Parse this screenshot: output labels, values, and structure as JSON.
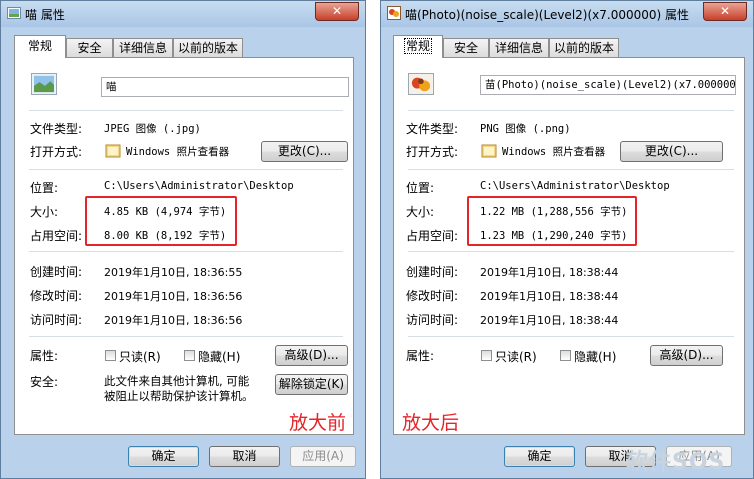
{
  "left": {
    "title": "喵 属性",
    "close": "✕",
    "tabs": [
      "常规",
      "安全",
      "详细信息",
      "以前的版本"
    ],
    "filename": "喵",
    "file_type_label": "文件类型:",
    "file_type": "JPEG 图像 (.jpg)",
    "opens_with_label": "打开方式:",
    "opens_with": "Windows 照片查看器",
    "change_button": "更改(C)...",
    "location_label": "位置:",
    "location": "C:\\Users\\Administrator\\Desktop",
    "size_label": "大小:",
    "size": "4.85 KB (4,974 字节)",
    "size_on_disk_label": "占用空间:",
    "size_on_disk": "8.00 KB (8,192 字节)",
    "created_label": "创建时间:",
    "created": "2019年1月10日, 18:36:55",
    "modified_label": "修改时间:",
    "modified": "2019年1月10日, 18:36:56",
    "accessed_label": "访问时间:",
    "accessed": "2019年1月10日, 18:36:56",
    "attributes_label": "属性:",
    "readonly_label": "只读(R)",
    "hidden_label": "隐藏(H)",
    "advanced_button": "高级(D)...",
    "security_label": "安全:",
    "security_text_1": "此文件来自其他计算机, 可能",
    "security_text_2": "被阻止以帮助保护该计算机。",
    "unblock_button": "解除锁定(K)",
    "ok_button": "确定",
    "cancel_button": "取消",
    "apply_button": "应用(A)",
    "annotation": "放大前"
  },
  "right": {
    "title": "喵(Photo)(noise_scale)(Level2)(x7.000000) 属性",
    "close": "✕",
    "tabs": [
      "常规",
      "安全",
      "详细信息",
      "以前的版本"
    ],
    "filename": "苗(Photo)(noise_scale)(Level2)(x7.000000)",
    "file_type_label": "文件类型:",
    "file_type": "PNG 图像 (.png)",
    "opens_with_label": "打开方式:",
    "opens_with": "Windows 照片查看器",
    "change_button": "更改(C)...",
    "location_label": "位置:",
    "location": "C:\\Users\\Administrator\\Desktop",
    "size_label": "大小:",
    "size": "1.22 MB (1,288,556 字节)",
    "size_on_disk_label": "占用空间:",
    "size_on_disk": "1.23 MB (1,290,240 字节)",
    "created_label": "创建时间:",
    "created": "2019年1月10日, 18:38:44",
    "modified_label": "修改时间:",
    "modified": "2019年1月10日, 18:38:44",
    "accessed_label": "访问时间:",
    "accessed": "2019年1月10日, 18:38:44",
    "attributes_label": "属性:",
    "readonly_label": "只读(R)",
    "hidden_label": "隐藏(H)",
    "advanced_button": "高级(D)...",
    "ok_button": "确定",
    "cancel_button": "取消",
    "apply_button": "应用(A)",
    "annotation": "放大后"
  },
  "watermark": "软件SOS",
  "colors": {
    "annotation_red": "#e4252a",
    "window_frame": "#b9d1ea"
  }
}
